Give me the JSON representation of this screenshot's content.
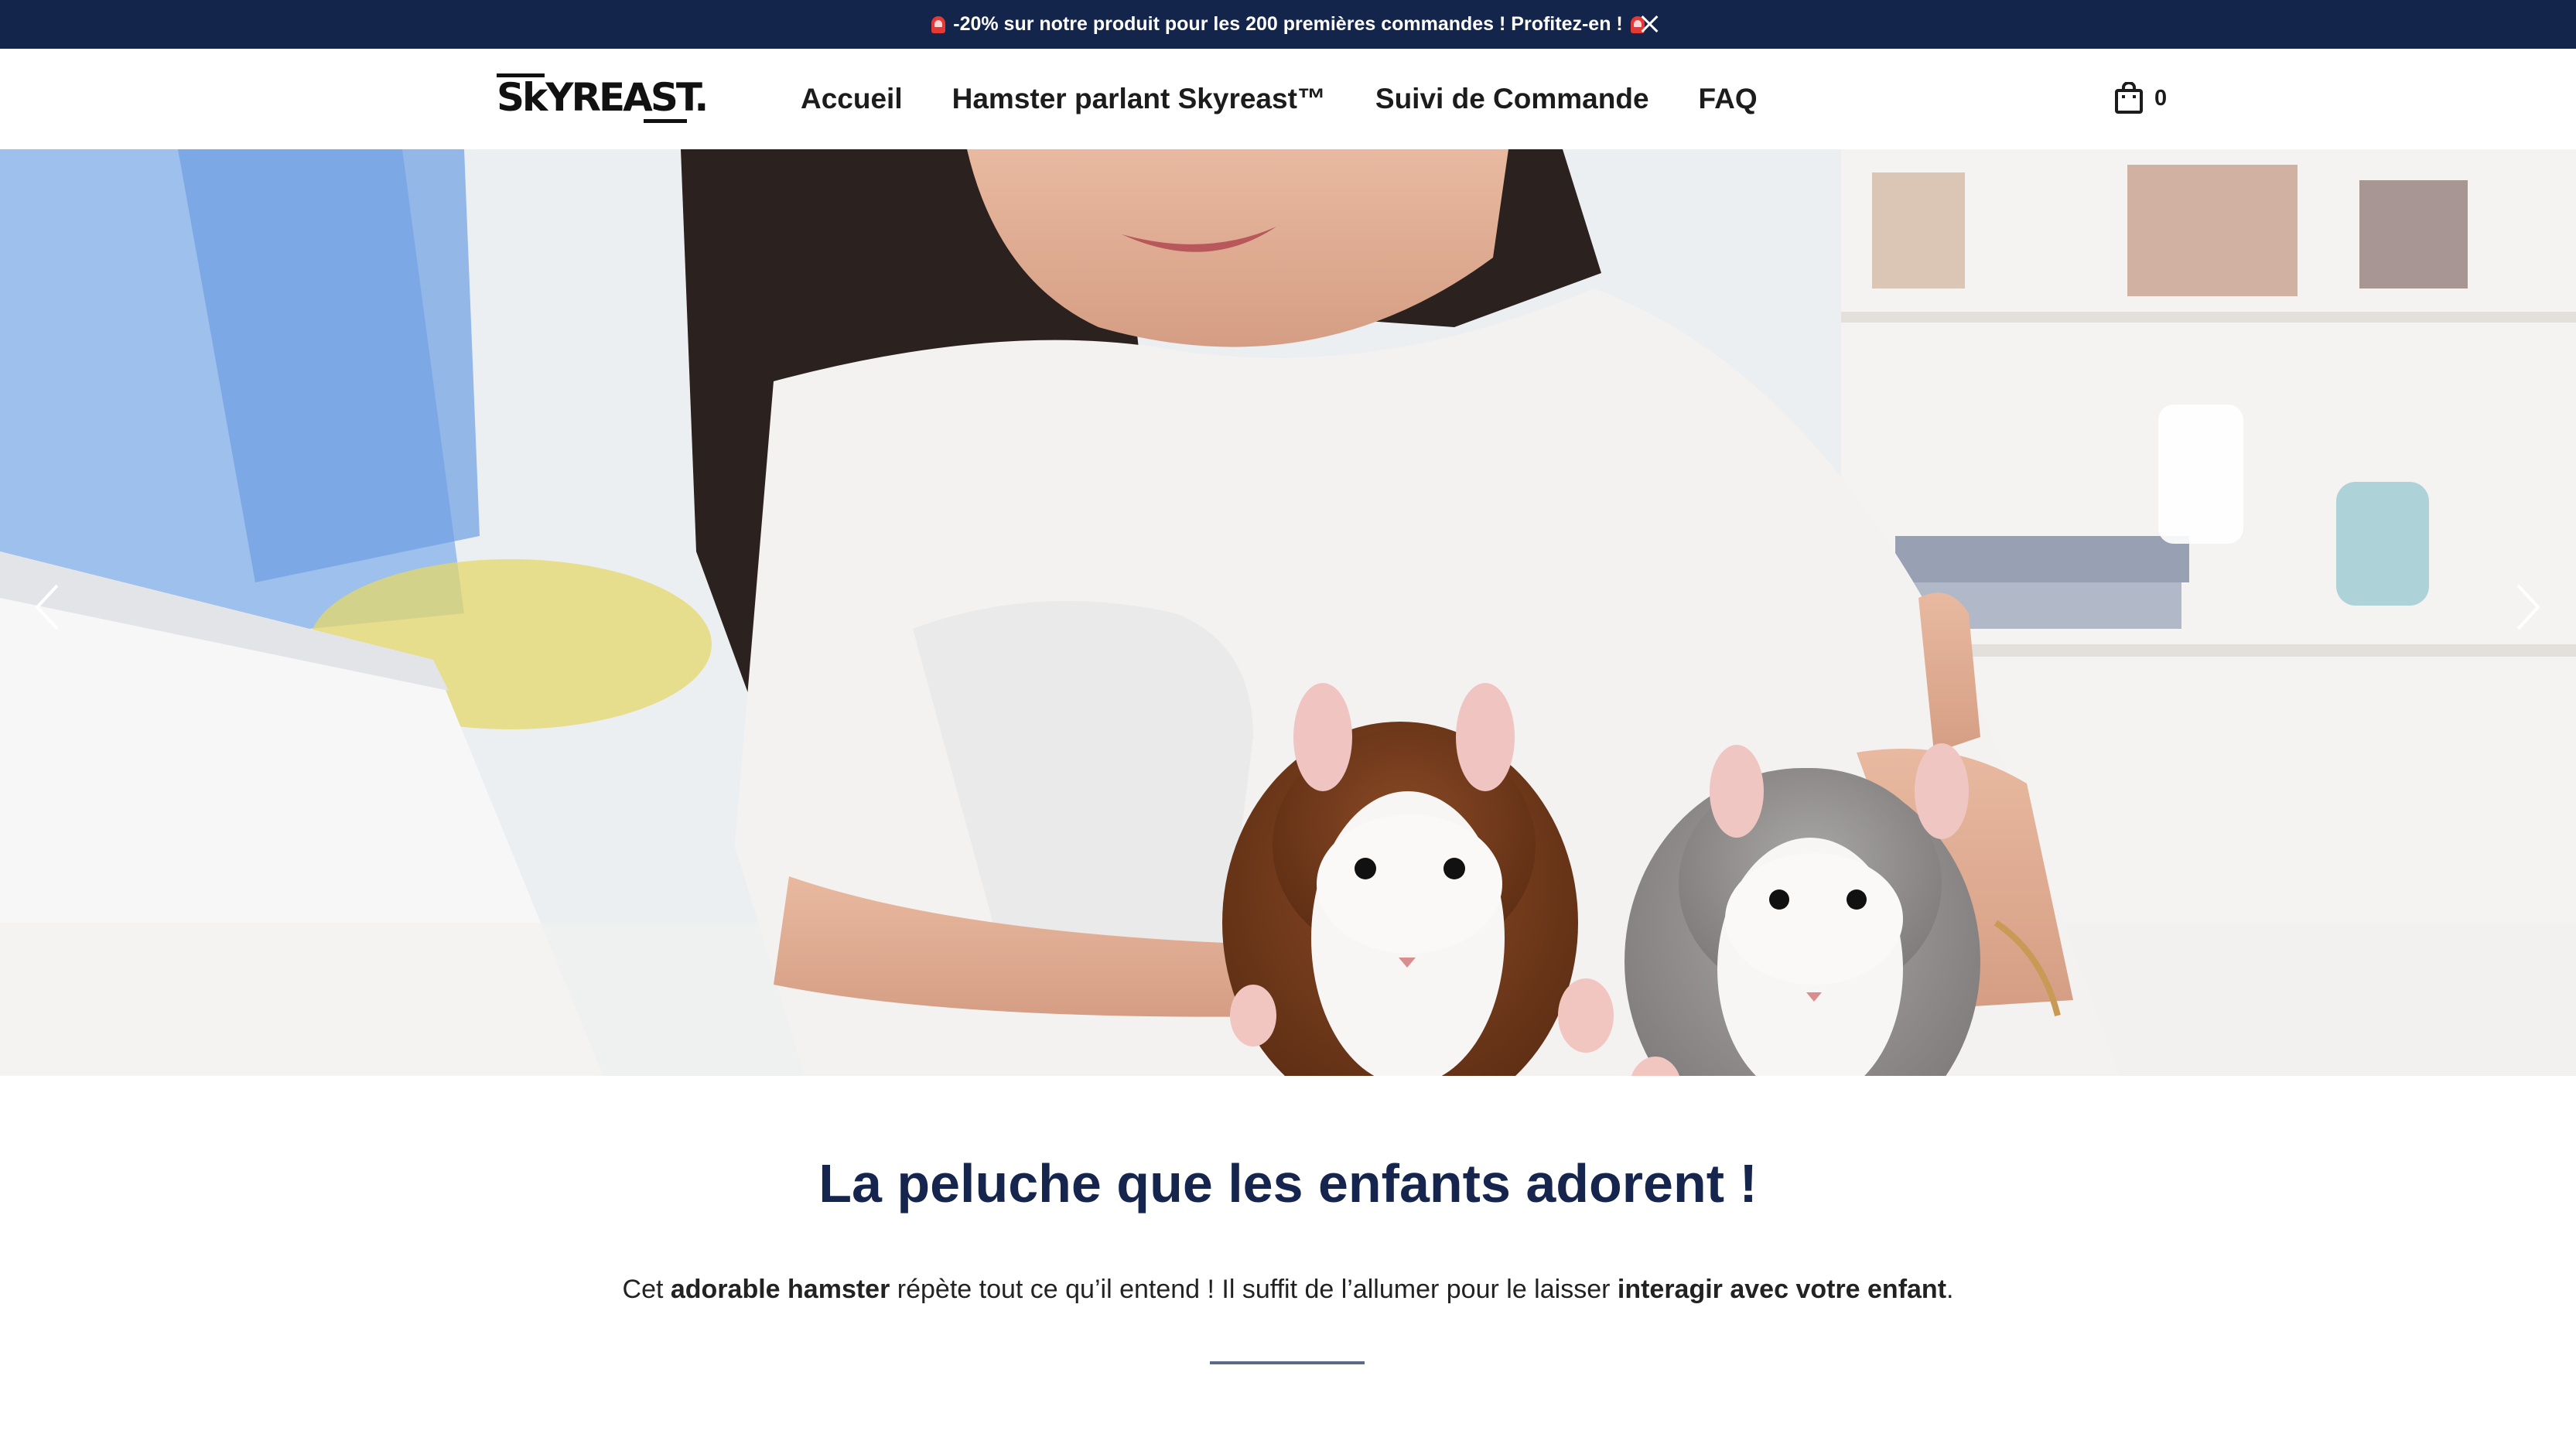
{
  "announcement": {
    "text": "-20% sur notre produit pour les 200 premières commandes ! Profitez-en !",
    "icon": "siren-emoji-icon",
    "close_icon": "close-icon"
  },
  "header": {
    "logo_text": "SkYREAST.",
    "nav": [
      {
        "label": "Accueil"
      },
      {
        "label": "Hamster parlant Skyreast™"
      },
      {
        "label": "Suivi de Commande"
      },
      {
        "label": "FAQ"
      }
    ],
    "cart": {
      "icon": "shopping-bag-icon",
      "count": "0"
    }
  },
  "hero": {
    "prev_icon": "chevron-left-icon",
    "next_icon": "chevron-right-icon"
  },
  "content": {
    "headline": "La peluche que les enfants adorent !",
    "sub_parts": [
      "Cet ",
      "adorable hamster",
      " répète tout ce qu’il entend ! Il suffit de l’allumer pour le laisser ",
      "interagir avec votre enfant",
      "."
    ]
  },
  "colors": {
    "announcement_bg": "#13254b",
    "headline": "#15254d",
    "divider": "#5b6a86"
  }
}
